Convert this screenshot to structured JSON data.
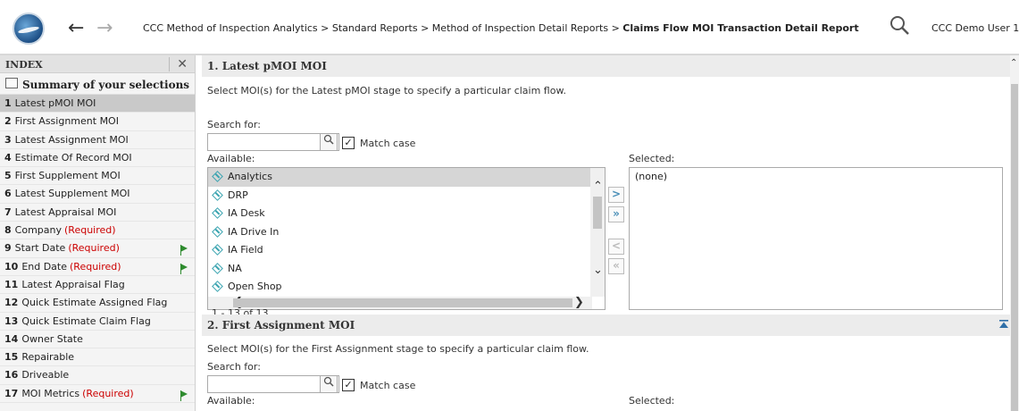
{
  "header": {
    "breadcrumb": "CCC Method of Inspection Analytics > Standard Reports > Method of Inspection Detail Reports > ",
    "current_page": "Claims Flow MOI Transaction Detail Report",
    "user": "CCC Demo User 1",
    "icons": {
      "back": "arrow-left-icon",
      "forward": "arrow-right-icon",
      "search": "search-icon",
      "logo": "ccc-logo"
    }
  },
  "index": {
    "title": "INDEX",
    "close": "✕",
    "summary": "Summary of your selections",
    "items": [
      {
        "num": "1",
        "label": "Latest pMOI MOI",
        "required": "",
        "flag": false,
        "active": true
      },
      {
        "num": "2",
        "label": "First Assignment MOI",
        "required": "",
        "flag": false
      },
      {
        "num": "3",
        "label": "Latest Assignment MOI",
        "required": "",
        "flag": false
      },
      {
        "num": "4",
        "label": "Estimate Of Record MOI",
        "required": "",
        "flag": false
      },
      {
        "num": "5",
        "label": "First Supplement MOI",
        "required": "",
        "flag": false
      },
      {
        "num": "6",
        "label": "Latest Supplement MOI",
        "required": "",
        "flag": false
      },
      {
        "num": "7",
        "label": "Latest Appraisal MOI",
        "required": "",
        "flag": false
      },
      {
        "num": "8",
        "label": "Company",
        "required": "(Required)",
        "flag": false
      },
      {
        "num": "9",
        "label": "Start Date",
        "required": "(Required)",
        "flag": true
      },
      {
        "num": "10",
        "label": "End Date",
        "required": "(Required)",
        "flag": true
      },
      {
        "num": "11",
        "label": "Latest Appraisal Flag",
        "required": "",
        "flag": false
      },
      {
        "num": "12",
        "label": "Quick Estimate Assigned Flag",
        "required": "",
        "flag": false
      },
      {
        "num": "13",
        "label": "Quick Estimate Claim Flag",
        "required": "",
        "flag": false
      },
      {
        "num": "14",
        "label": "Owner State",
        "required": "",
        "flag": false
      },
      {
        "num": "15",
        "label": "Repairable",
        "required": "",
        "flag": false
      },
      {
        "num": "16",
        "label": "Driveable",
        "required": "",
        "flag": false
      },
      {
        "num": "17",
        "label": "MOI Metrics",
        "required": "(Required)",
        "flag": true
      }
    ]
  },
  "section1": {
    "title": "1. Latest pMOI MOI",
    "description": "Select MOI(s) for the Latest pMOI stage to specify a particular claim flow.",
    "search_label": "Search for:",
    "search_value": "",
    "match_case": "Match case",
    "match_checked": "✓",
    "available_label": "Available:",
    "selected_label": "Selected:",
    "available": [
      "Analytics",
      "DRP",
      "IA Desk",
      "IA Drive In",
      "IA Field",
      "NA",
      "Open Shop"
    ],
    "selected": "(none)",
    "count": "1 - 13 of 13",
    "move_buttons": {
      "add": ">",
      "add_all": "»",
      "remove": "<",
      "remove_all": "«"
    }
  },
  "section2": {
    "title": "2. First Assignment MOI",
    "description": "Select MOI(s) for the First Assignment stage to specify a particular claim flow.",
    "search_label": "Search for:",
    "match_case": "Match case",
    "match_checked": "✓",
    "available_label": "Available:",
    "selected_label": "Selected:"
  }
}
